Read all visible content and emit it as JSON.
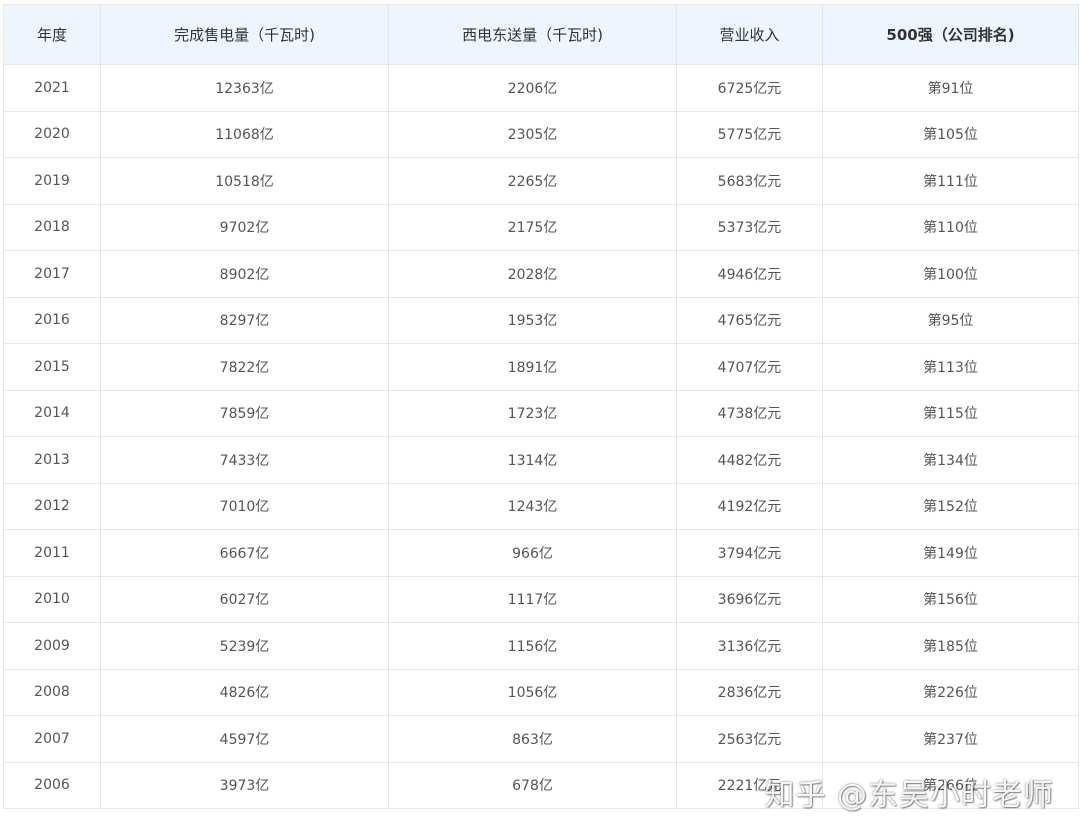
{
  "table": {
    "headers": [
      "年度",
      "完成售电量（千瓦时)",
      "西电东送量（千瓦时)",
      "营业收入",
      "500强（公司排名)"
    ],
    "rows": [
      [
        "2021",
        "12363亿",
        "2206亿",
        "6725亿元",
        "第91位"
      ],
      [
        "2020",
        "11068亿",
        "2305亿",
        "5775亿元",
        "第105位"
      ],
      [
        "2019",
        "10518亿",
        "2265亿",
        "5683亿元",
        "第111位"
      ],
      [
        "2018",
        "9702亿",
        "2175亿",
        "5373亿元",
        "第110位"
      ],
      [
        "2017",
        "8902亿",
        "2028亿",
        "4946亿元",
        "第100位"
      ],
      [
        "2016",
        "8297亿",
        "1953亿",
        "4765亿元",
        "第95位"
      ],
      [
        "2015",
        "7822亿",
        "1891亿",
        "4707亿元",
        "第113位"
      ],
      [
        "2014",
        "7859亿",
        "1723亿",
        "4738亿元",
        "第115位"
      ],
      [
        "2013",
        "7433亿",
        "1314亿",
        "4482亿元",
        "第134位"
      ],
      [
        "2012",
        "7010亿",
        "1243亿",
        "4192亿元",
        "第152位"
      ],
      [
        "2011",
        "6667亿",
        "966亿",
        "3794亿元",
        "第149位"
      ],
      [
        "2010",
        "6027亿",
        "1117亿",
        "3696亿元",
        "第156位"
      ],
      [
        "2009",
        "5239亿",
        "1156亿",
        "3136亿元",
        "第185位"
      ],
      [
        "2008",
        "4826亿",
        "1056亿",
        "2836亿元",
        "第226位"
      ],
      [
        "2007",
        "4597亿",
        "863亿",
        "2563亿元",
        "第237位"
      ],
      [
        "2006",
        "3973亿",
        "678亿",
        "2221亿元",
        "第266位"
      ]
    ]
  },
  "watermark": "知乎 @东吴小时老师"
}
